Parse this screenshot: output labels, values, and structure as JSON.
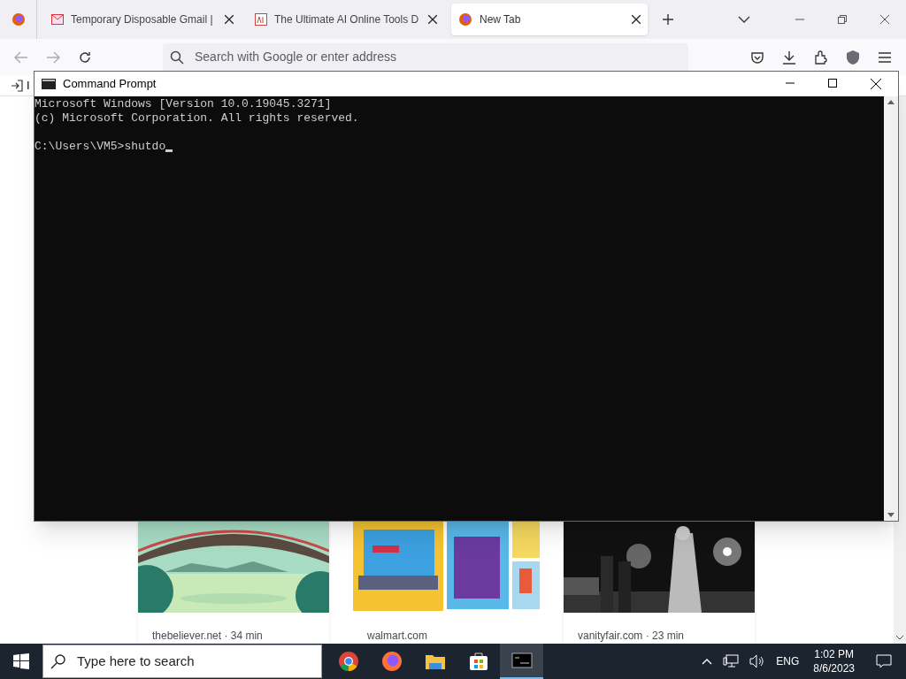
{
  "browser": {
    "tabs": [
      {
        "title": "Temporary Disposable Gmail |",
        "kind": "mail",
        "selected": false
      },
      {
        "title": "The Ultimate AI Online Tools D",
        "kind": "ai",
        "selected": false
      },
      {
        "title": "New Tab",
        "kind": "firefox",
        "selected": true
      }
    ],
    "address": {
      "placeholder": "Search with Google or enter address"
    },
    "bookmark_item": "I",
    "cards": [
      {
        "kind": "bridge",
        "source": "thebeliever.net · 34 min"
      },
      {
        "kind": "products",
        "source": "walmart.com"
      },
      {
        "kind": "concert",
        "source": "vanityfair.com · 23 min"
      }
    ]
  },
  "console_window": {
    "title": "Command Prompt",
    "lines": [
      "Microsoft Windows [Version 10.0.19045.3271]",
      "(c) Microsoft Corporation. All rights reserved."
    ],
    "prompt": "C:\\Users\\VM5>shutdo"
  },
  "taskbar": {
    "search": {
      "placeholder": "Type here to search"
    },
    "apps": [
      {
        "kind": "chrome",
        "active": false
      },
      {
        "kind": "firefox",
        "active": false
      },
      {
        "kind": "explorer",
        "active": false
      },
      {
        "kind": "store",
        "active": false
      },
      {
        "kind": "console",
        "active": true
      }
    ],
    "language": "ENG",
    "time": "1:02 PM",
    "date": "8/6/2023"
  }
}
